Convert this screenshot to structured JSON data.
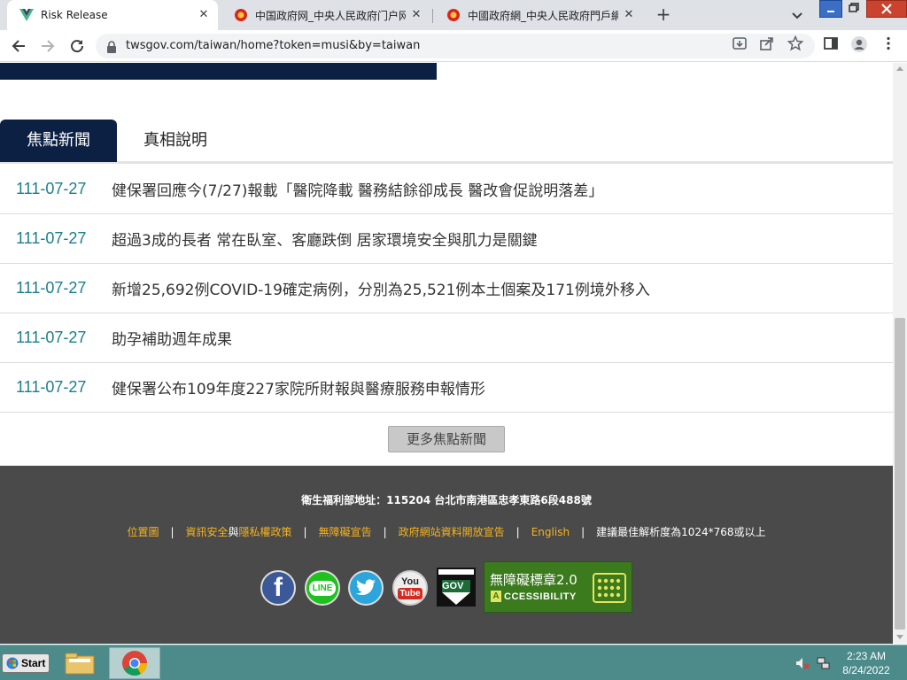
{
  "browser": {
    "tabs": [
      {
        "title": "Risk Release",
        "active": true
      },
      {
        "title": "中国政府网_中央人民政府门户网",
        "active": false
      },
      {
        "title": "中國政府網_中央人民政府門戶網",
        "active": false
      }
    ],
    "url": "twsgov.com/taiwan/home?token=musi&by=taiwan"
  },
  "page": {
    "tabs": [
      "焦點新聞",
      "真相說明"
    ],
    "news": [
      {
        "date": "111-07-27",
        "title": "健保署回應今(7/27)報載「醫院降載 醫務結餘卻成長 醫改會促說明落差」"
      },
      {
        "date": "111-07-27",
        "title": "超過3成的長者 常在臥室、客廳跌倒 居家環境安全與肌力是關鍵"
      },
      {
        "date": "111-07-27",
        "title": "新增25,692例COVID-19確定病例，分別為25,521例本土個案及171例境外移入"
      },
      {
        "date": "111-07-27",
        "title": "助孕補助週年成果"
      },
      {
        "date": "111-07-27",
        "title": "健保署公布109年度227家院所財報與醫療服務申報情形"
      }
    ],
    "more_button": "更多焦點新聞"
  },
  "footer": {
    "address": "衛生福利部地址：115204 台北市南港區忠孝東路6段488號",
    "links": {
      "sitemap": "位置圖",
      "security": "資訊安全",
      "and": "與",
      "privacy": "隱私權政策",
      "accessibility": "無障礙宣告",
      "open_data": "政府網站資料開放宣告",
      "english": "English",
      "resolution": "建議最佳解析度為1024*768或以上"
    },
    "social": {
      "facebook": "f",
      "line": "LINE",
      "youtube_you": "You",
      "youtube_tube": "Tube",
      "gov": "GOV"
    },
    "a11y_badge": {
      "title": "無障礙標章2.0",
      "subtitle": "CCESSIBILITY",
      "letter": "A"
    }
  },
  "taskbar": {
    "start": "Start",
    "time": "2:23 AM",
    "date": "8/24/2022"
  },
  "colors": {
    "navy": "#0c2044",
    "date_teal": "#1c7e8c",
    "footer_bg": "#4a4a4a",
    "link_orange": "#f5b31d",
    "taskbar": "#4d8a8a"
  }
}
